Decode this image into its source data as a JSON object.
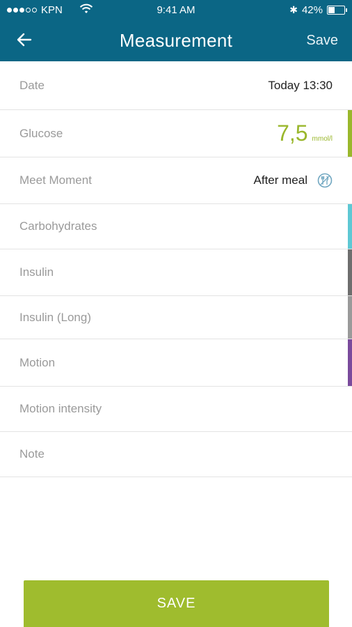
{
  "status_bar": {
    "carrier": "KPN",
    "time": "9:41 AM",
    "battery": "42%",
    "battery_level": 0.42
  },
  "app_bar": {
    "title": "Measurement",
    "save_label": "Save",
    "background": "#0b6685"
  },
  "rows": {
    "date": {
      "label": "Date",
      "value": "Today 13:30"
    },
    "glucose": {
      "label": "Glucose",
      "value": "7,5",
      "unit": "mmol/l",
      "accent": "#9ab72c"
    },
    "meet_moment": {
      "label": "Meet Moment",
      "value": "After meal"
    },
    "carbohydrates": {
      "label": "Carbohydrates",
      "accent": "#5ec8d4"
    },
    "insulin": {
      "label": "Insulin",
      "accent": "#6e6e6e"
    },
    "insulin_long": {
      "label": "Insulin (Long)",
      "accent": "#9a9a9a"
    },
    "motion": {
      "label": "Motion",
      "accent": "#7a4a9c"
    },
    "motion_intensity": {
      "label": "Motion intensity"
    },
    "note": {
      "label": "Note"
    }
  },
  "save_button": {
    "label": "SAVE",
    "color": "#9fbc2e"
  },
  "icons": [
    "wifi-icon",
    "bluetooth-icon",
    "battery-icon",
    "back-arrow-icon",
    "meal-icon"
  ]
}
